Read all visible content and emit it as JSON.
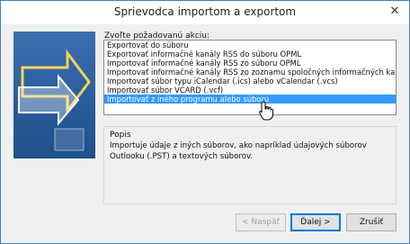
{
  "window": {
    "title": "Sprievodca importom a exportom"
  },
  "prompt": "Zvoľte požadovanú akciu:",
  "actions": [
    "Exportovať do súboru",
    "Exportovať informačné kanály RSS do súboru OPML",
    "Importovať informačné kanály RSS zo súboru OPML",
    "Importovať informačné kanály RSS zo zoznamu spoločných informačných kanálov",
    "Importovať súbor typu iCalendar (.ics) alebo vCalendar (.vcs)",
    "Importovať súbor VCARD (.vcf)",
    "Importovať z iného programu alebo súboru"
  ],
  "selected_index": 6,
  "description": {
    "title": "Popis",
    "text": "Importuje údaje z iných súborov, ako napríklad údajových súborov Outlooku (.PST) a textových súborov."
  },
  "buttons": {
    "back": "< Naspäť",
    "next": "Ďalej >",
    "cancel": "Zrušiť"
  },
  "colors": {
    "selection": "#3399ff",
    "window_border": "#3c80c6"
  }
}
